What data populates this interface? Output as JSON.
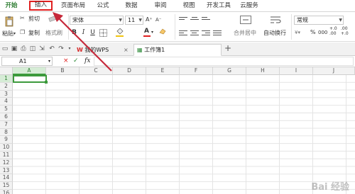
{
  "menu": {
    "items": [
      {
        "label": "开始",
        "state": "active"
      },
      {
        "label": "插入",
        "state": "highlighted"
      },
      {
        "label": "页面布局",
        "state": ""
      },
      {
        "label": "公式",
        "state": ""
      },
      {
        "label": "数据",
        "state": ""
      },
      {
        "label": "审阅",
        "state": ""
      },
      {
        "label": "视图",
        "state": ""
      },
      {
        "label": "开发工具",
        "state": ""
      },
      {
        "label": "云服务",
        "state": ""
      }
    ]
  },
  "ribbon": {
    "paste_label": "粘贴",
    "cut_label": "剪切",
    "copy_label": "复制",
    "format_painter_label": "格式刷",
    "font_name": "宋体",
    "font_size": "11",
    "bold": "B",
    "italic": "I",
    "underline": "U",
    "font_color": "A",
    "font_grow": "A⁺",
    "font_shrink": "A⁻",
    "merge_label": "合并居中",
    "wrap_label": "自动换行",
    "number_format": "常规",
    "percent": "%",
    "thousands": "000",
    "inc_decimal": "+.0\n.00",
    "dec_decimal": ".00\n+.0"
  },
  "tabs": {
    "items": [
      {
        "label": "我的WPS"
      },
      {
        "label": "工作簿1"
      }
    ],
    "new_tab": "+"
  },
  "formula": {
    "cell_ref": "A1",
    "cancel": "×",
    "confirm": "✓",
    "fx": "fx",
    "value": ""
  },
  "grid": {
    "columns": [
      "A",
      "B",
      "C",
      "D",
      "E",
      "F",
      "G",
      "H",
      "I",
      "J"
    ],
    "rows": [
      "1",
      "2",
      "3",
      "4",
      "5",
      "6",
      "7",
      "8",
      "9",
      "10",
      "11",
      "12",
      "13",
      "14",
      "15",
      "16"
    ],
    "selected_cell": "A1"
  },
  "watermark": "Bai 经验",
  "colors": {
    "accent": "#3c9a3c",
    "highlight_box": "#e02020",
    "annotation_arrow": "#c6283a"
  }
}
